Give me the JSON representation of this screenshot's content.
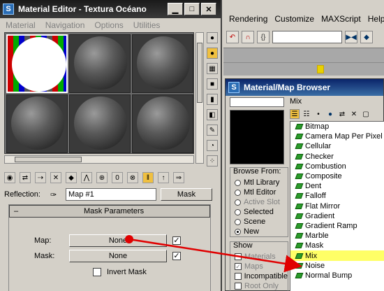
{
  "max_menu": {
    "items": [
      "Rendering",
      "Customize",
      "MAXScript",
      "Help"
    ]
  },
  "material_editor": {
    "title": "Material Editor - Textura Océano",
    "menu": [
      "Material",
      "Navigation",
      "Options",
      "Utilities"
    ],
    "reflection_label": "Reflection:",
    "map_name": "Map #1",
    "map_type": "Mask",
    "rollout_title": "Mask Parameters",
    "rollout_toggle": "–",
    "map_label": "Map:",
    "map_value": "None",
    "mask_label": "Mask:",
    "mask_value": "None",
    "invert_label": "Invert Mask"
  },
  "map_browser": {
    "title": "Material/Map Browser",
    "current": "Mix",
    "browse_from_title": "Browse From:",
    "browse_from": [
      {
        "label": "Mtl Library",
        "selected": false,
        "disabled": false
      },
      {
        "label": "Mtl Editor",
        "selected": false,
        "disabled": false
      },
      {
        "label": "Active Slot",
        "selected": false,
        "disabled": true
      },
      {
        "label": "Selected",
        "selected": false,
        "disabled": false
      },
      {
        "label": "Scene",
        "selected": false,
        "disabled": false
      },
      {
        "label": "New",
        "selected": true,
        "disabled": false
      }
    ],
    "show_title": "Show",
    "show": [
      {
        "label": "Materials",
        "checked": false,
        "disabled": true
      },
      {
        "label": "Maps",
        "checked": true,
        "disabled": true
      },
      {
        "label": "Incompatible",
        "checked": false,
        "disabled": false
      },
      {
        "label": "Root Only",
        "checked": false,
        "disabled": true
      }
    ],
    "maps": [
      "Bitmap",
      "Camera Map Per Pixel",
      "Cellular",
      "Checker",
      "Combustion",
      "Composite",
      "Dent",
      "Falloff",
      "Flat Mirror",
      "Gradient",
      "Gradient Ramp",
      "Marble",
      "Mask",
      "Mix",
      "Noise",
      "Normal Bump"
    ],
    "selected_map": "Mix"
  },
  "colors": {
    "accent_arrow": "#e00000",
    "selection": "#ffff66",
    "map_icon": "#2a9a2a"
  }
}
